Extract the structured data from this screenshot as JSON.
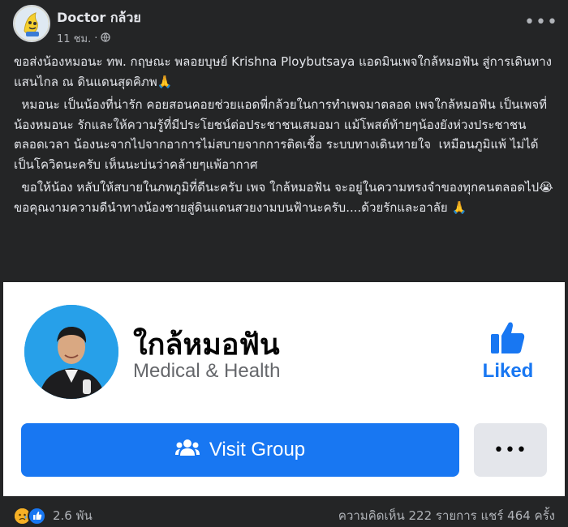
{
  "header": {
    "author": "Doctor กล้วย",
    "time": "11 ชม.",
    "dot": "·",
    "privacy_icon": "globe-icon",
    "more_icon": "more-horizontal-icon"
  },
  "content": {
    "paragraphs": [
      "ขอส่งน้องหมอนะ ทพ. กฤษณะ พลอยบุษย์ Krishna Ploybutsaya แอดมินเพจใกล้หมอฟัน สู่การเดินทางแสนไกล ณ ดินแดนสุดคิภพ🙏",
      "  หมอนะ เป็นน้องที่น่ารัก คอยสอนคอยช่วยแอดพี่กล้วยในการทำเพจมาตลอด เพจใกล้หมอฟัน เป็นเพจที่น้องหมอนะ รักและให้ความรู้ที่มีประโยชน์ต่อประชาชนเสมอมา แม้โพสต์ท้ายๆน้องยังห่วงประชาชนตลอดเวลา น้องนะจากไปจากอาการไม่สบายจากการติดเชื้อ ระบบทางเดินหายใจ  เหมือนภูมิแพ้ ไม่ได้เป็นโควิดนะครับ เห็นนะบ่นว่าคล้ายๆแพ้อากาศ",
      "  ขอให้น้อง หลับให้สบายในภพภูมิที่ดีนะครับ เพจ ใกล้หมอฟัน จะอยู่ในความทรงจำของทุกคนตลอดไป😭 ขอคุณงามความดีนำทางน้องชายสู่ดินแดนสวยงามบนฟ้านะครับ....ด้วยรักและอาลัย 🙏"
    ]
  },
  "card": {
    "page_name": "ใกล้หมอฟัน",
    "category": "Medical & Health",
    "liked_label": "Liked",
    "like_icon": "thumbs-up-icon",
    "visit_label": "Visit Group",
    "group_icon": "group-icon",
    "more_icon": "more-horizontal-icon",
    "colors": {
      "accent": "#1877f2",
      "card_bg": "#ffffff",
      "photo_bg": "#27a0e9"
    }
  },
  "footer": {
    "reactions": [
      "sad-reaction-icon",
      "like-reaction-icon"
    ],
    "reaction_count": "2.6 พัน",
    "stats": "ความคิดเห็น 222 รายการ แชร์ 464 ครั้ง"
  },
  "colors": {
    "background": "#242526",
    "text": "#e4e6eb",
    "secondary_text": "#b0b3b8"
  }
}
